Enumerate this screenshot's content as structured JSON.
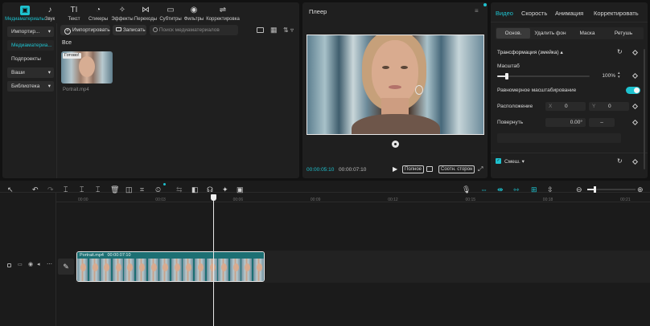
{
  "toolbar": {
    "items": [
      {
        "label": "Медиаматериалы",
        "icon": "media-icon",
        "active": true
      },
      {
        "label": "Звук",
        "icon": "audio-icon"
      },
      {
        "label": "Текст",
        "icon": "text-icon"
      },
      {
        "label": "Стикеры",
        "icon": "sticker-icon"
      },
      {
        "label": "Эффекты",
        "icon": "effects-icon"
      },
      {
        "label": "Переходы",
        "icon": "transitions-icon"
      },
      {
        "label": "Субтитры",
        "icon": "subtitles-icon"
      },
      {
        "label": "Фильтры",
        "icon": "filters-icon"
      },
      {
        "label": "Корректировка",
        "icon": "adjust-icon"
      }
    ]
  },
  "sidebar": {
    "items": [
      {
        "label": "Импортир..."
      },
      {
        "label": "Медиаматериа..."
      },
      {
        "label": "Подпроекты"
      },
      {
        "label": "Ваши"
      },
      {
        "label": "Библиотека"
      }
    ]
  },
  "media": {
    "import_label": "Импортировать",
    "record_label": "Записать",
    "search_placeholder": "Поиск медиаматериалов",
    "filter_all": "Все",
    "clip_badge": "Готово!",
    "clip_name": "Portrait.mp4"
  },
  "player": {
    "title": "Плеер",
    "current_time": "00:00:05:10",
    "total_time": "00:00:07:10",
    "quality_label": "Полное",
    "ratio_label": "Соотн. сторон"
  },
  "properties": {
    "tabs": [
      "Видео",
      "Скорость",
      "Анимация",
      "Корректировать"
    ],
    "subtabs": [
      "Основ.",
      "Удалить фон",
      "Маска",
      "Ретушь"
    ],
    "transform_label": "Трансформация (змейка)",
    "scale_label": "Масштаб",
    "scale_value": "100%",
    "scale_level": 0.1,
    "uniform_label": "Равномерное масштабирование",
    "position_label": "Расположение",
    "pos_x_label": "X",
    "pos_x": "0",
    "pos_y_label": "Y",
    "pos_y": "0",
    "rotate_label": "Повернуть",
    "rotate_value": "0.00°",
    "blend_label": "Смеш."
  },
  "timeline": {
    "ruler_labels": [
      "00:00",
      "00:03",
      "00:06",
      "00:09",
      "00:12",
      "00:15",
      "00:18",
      "00:21"
    ],
    "clip_name": "Portrait.mp4",
    "clip_duration": "00:00:07:10"
  },
  "colors": {
    "accent": "#1ec2cf",
    "clip": "#1c6f73"
  }
}
